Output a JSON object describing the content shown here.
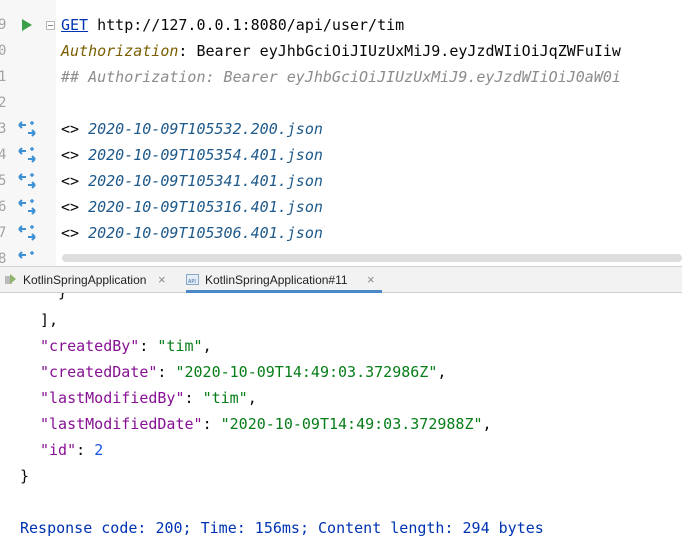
{
  "editor": {
    "line_numbers": [
      "9",
      "0",
      "1",
      "2",
      "3",
      "4",
      "5",
      "6",
      "7",
      "8"
    ],
    "request": {
      "method": "GET",
      "url": "http://127.0.0.1:8080/api/user/tim"
    },
    "auth_header": {
      "name": "Authorization",
      "separator": ": ",
      "value": "Bearer eyJhbGciOiJIUzUxMiJ9.eyJzdWIiOiJqZWFuIiw"
    },
    "comment_line": "## Authorization: Bearer eyJhbGciOiJIUzUxMiJ9.eyJzdWIiOiJ0aW0i",
    "response_refs": [
      {
        "prefix": "<>",
        "file": "2020-10-09T105532.200.json"
      },
      {
        "prefix": "<>",
        "file": "2020-10-09T105354.401.json"
      },
      {
        "prefix": "<>",
        "file": "2020-10-09T105341.401.json"
      },
      {
        "prefix": "<>",
        "file": "2020-10-09T105316.401.json"
      },
      {
        "prefix": "<>",
        "file": "2020-10-09T105306.401.json"
      }
    ]
  },
  "tabs": [
    {
      "label": "KotlinSpringApplication",
      "close": "×"
    },
    {
      "label": "KotlinSpringApplication#11",
      "close": "×"
    }
  ],
  "response": {
    "partial_brace": "}",
    "array_close": "],",
    "fields": [
      {
        "key": "\"createdBy\"",
        "colon": ": ",
        "value": "\"tim\"",
        "comma": ","
      },
      {
        "key": "\"createdDate\"",
        "colon": ": ",
        "value": "\"2020-10-09T14:49:03.372986Z\"",
        "comma": ","
      },
      {
        "key": "\"lastModifiedBy\"",
        "colon": ": ",
        "value": "\"tim\"",
        "comma": ","
      },
      {
        "key": "\"lastModifiedDate\"",
        "colon": ": ",
        "value": "\"2020-10-09T14:49:03.372988Z\"",
        "comma": ","
      },
      {
        "key": "\"id\"",
        "colon": ": ",
        "value": "2",
        "comma": ""
      }
    ],
    "close_brace": "}",
    "status_line": "Response code: 200; Time: 156ms; Content length: 294 bytes"
  },
  "colors": {
    "run_icon": "#3c9f4a",
    "swap_icon": "#3d8fd6",
    "active_tab_underline": "#4a88c7"
  },
  "icons": [
    "run-icon",
    "fold-icon",
    "swap-arrows-icon",
    "app-icon",
    "api-icon",
    "close-icon"
  ]
}
